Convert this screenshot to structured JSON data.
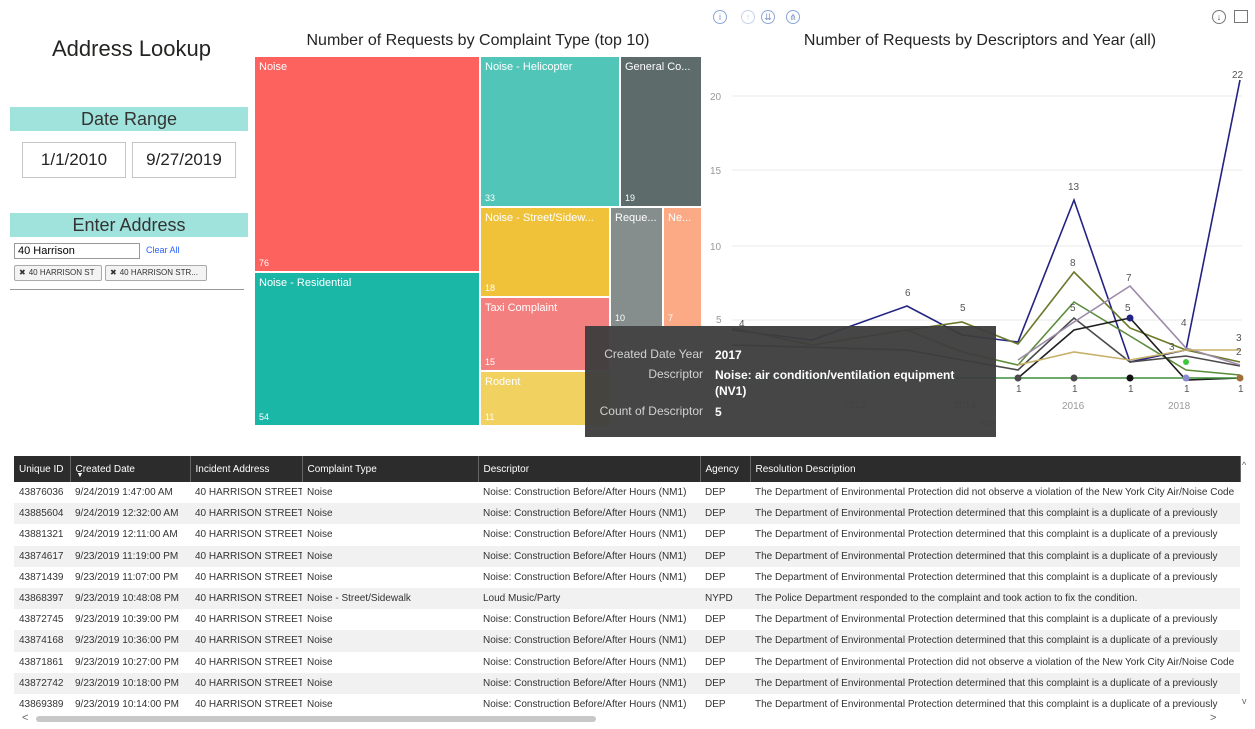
{
  "app_title": "Address Lookup",
  "date_range": {
    "title": "Date Range",
    "start": "1/1/2010",
    "end": "9/27/2019"
  },
  "address": {
    "title": "Enter Address",
    "value": "40 Harrison",
    "clear_label": "Clear All",
    "chips": [
      "40 HARRISON ST",
      "40 HARRISON STR..."
    ],
    "chip_close": "✖"
  },
  "treemap": {
    "title": "Number of Requests by Complaint Type (top 10)",
    "tiles": [
      {
        "label": "Noise",
        "value": "76",
        "color": "#fd625e"
      },
      {
        "label": "Noise - Residential",
        "value": "54",
        "color": "#1ab7a7"
      },
      {
        "label": "Noise - Helicopter",
        "value": "33",
        "color": "#50c5b8"
      },
      {
        "label": "General Co...",
        "value": "19",
        "color": "#5d6b6b"
      },
      {
        "label": "Noise - Street/Sidew...",
        "value": "18",
        "color": "#efc23a"
      },
      {
        "label": "Reque...",
        "value": "10",
        "color": "#858d8d"
      },
      {
        "label": "Ne...",
        "value": "7",
        "color": "#fca985"
      },
      {
        "label": "Taxi Complaint",
        "value": "15",
        "color": "#f47f7f"
      },
      {
        "label": "Rodent",
        "value": "11",
        "color": "#f1d160"
      }
    ]
  },
  "line_chart": {
    "title": "Number of Requests by Descriptors and Year (all)",
    "y_ticks": [
      "20",
      "15",
      "10",
      "5"
    ],
    "x_ticks": [
      "2016",
      "2018"
    ],
    "axis_partial_labels": [
      "2012",
      "2014",
      "ear"
    ],
    "peak_labels": [
      "22",
      "13",
      "8",
      "7",
      "6",
      "5",
      "5",
      "5",
      "4",
      "3",
      "3",
      "2",
      "4",
      "1",
      "1",
      "1",
      "1",
      "1"
    ]
  },
  "tooltip": {
    "rows": [
      {
        "key": "Created Date Year",
        "value": "2017"
      },
      {
        "key": "Descriptor",
        "value": "Noise: air condition/ventilation equipment (NV1)"
      },
      {
        "key": "Count of Descriptor",
        "value": "5"
      }
    ]
  },
  "table": {
    "columns": [
      "Unique ID",
      "Created Date",
      "Incident Address",
      "Complaint Type",
      "Descriptor",
      "Agency",
      "Resolution Description"
    ],
    "rows": [
      [
        "43876036",
        "9/24/2019 1:47:00 AM",
        "40 HARRISON STREET",
        "Noise",
        "Noise: Construction Before/After Hours (NM1)",
        "DEP",
        "The Department of Environmental Protection did not observe a violation of the New York City Air/Noise Code"
      ],
      [
        "43885604",
        "9/24/2019 12:32:00 AM",
        "40 HARRISON STREET",
        "Noise",
        "Noise: Construction Before/After Hours (NM1)",
        "DEP",
        "The Department of Environmental Protection determined that this complaint is a duplicate of a previously"
      ],
      [
        "43881321",
        "9/24/2019 12:11:00 AM",
        "40 HARRISON STREET",
        "Noise",
        "Noise: Construction Before/After Hours (NM1)",
        "DEP",
        "The Department of Environmental Protection determined that this complaint is a duplicate of a previously"
      ],
      [
        "43874617",
        "9/23/2019 11:19:00 PM",
        "40 HARRISON STREET",
        "Noise",
        "Noise: Construction Before/After Hours (NM1)",
        "DEP",
        "The Department of Environmental Protection determined that this complaint is a duplicate of a previously"
      ],
      [
        "43871439",
        "9/23/2019 11:07:00 PM",
        "40 HARRISON STREET",
        "Noise",
        "Noise: Construction Before/After Hours (NM1)",
        "DEP",
        "The Department of Environmental Protection determined that this complaint is a duplicate of a previously"
      ],
      [
        "43868397",
        "9/23/2019 10:48:08 PM",
        "40 HARRISON STREET",
        "Noise - Street/Sidewalk",
        "Loud Music/Party",
        "NYPD",
        "The Police Department responded to the complaint and took action to fix the condition."
      ],
      [
        "43872745",
        "9/23/2019 10:39:00 PM",
        "40 HARRISON STREET",
        "Noise",
        "Noise: Construction Before/After Hours (NM1)",
        "DEP",
        "The Department of Environmental Protection determined that this complaint is a duplicate of a previously"
      ],
      [
        "43874168",
        "9/23/2019 10:36:00 PM",
        "40 HARRISON STREET",
        "Noise",
        "Noise: Construction Before/After Hours (NM1)",
        "DEP",
        "The Department of Environmental Protection determined that this complaint is a duplicate of a previously"
      ],
      [
        "43871861",
        "9/23/2019 10:27:00 PM",
        "40 HARRISON STREET",
        "Noise",
        "Noise: Construction Before/After Hours (NM1)",
        "DEP",
        "The Department of Environmental Protection did not observe a violation of the New York City Air/Noise Code"
      ],
      [
        "43872742",
        "9/23/2019 10:18:00 PM",
        "40 HARRISON STREET",
        "Noise",
        "Noise: Construction Before/After Hours (NM1)",
        "DEP",
        "The Department of Environmental Protection determined that this complaint is a duplicate of a previously"
      ],
      [
        "43869389",
        "9/23/2019 10:14:00 PM",
        "40 HARRISON STREET",
        "Noise",
        "Noise: Construction Before/After Hours (NM1)",
        "DEP",
        "The Department of Environmental Protection determined that this complaint is a duplicate of a previously"
      ]
    ]
  },
  "icons": {
    "info": "info-icon",
    "drill_up": "drill-up-icon",
    "expand_level": "expand-next-level-icon",
    "expand_hierarchy": "expand-hierarchy-icon",
    "drill_down": "drill-down-icon",
    "focus": "focus-mode-icon"
  }
}
